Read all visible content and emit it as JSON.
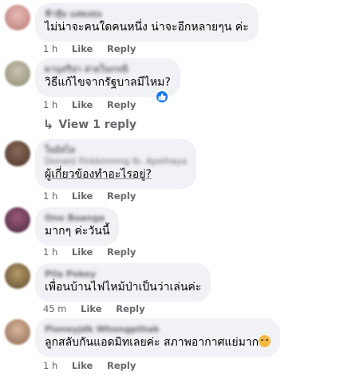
{
  "comments": [
    {
      "author": "ฟ้าสุ้ม แสดงธม",
      "text": "ไม่น่าจะคนใดคนหนึ่ง น่าจะอีกหลายๆน ค่ะ",
      "time": "1 h",
      "like": "Like",
      "reply": "Reply"
    },
    {
      "author": "ผานุจรีน่า ฝายในกรณี",
      "text": "วิธีแก้ไขจากรัฐบาลมีไหม?",
      "time": "1 h",
      "like": "Like",
      "reply": "Reply",
      "view_replies": "View 1 reply"
    },
    {
      "author": "ใจมัลไล",
      "author2": "Donald Finkkmmng Ib. Apelhaya",
      "text": "ผู้เกี่ยวข้องทำอะไรอยู่?",
      "time": "1 h",
      "like": "Like",
      "reply": "Reply"
    },
    {
      "author": "Ono Boanga",
      "text": "มากๆ ค่ะวันนี้",
      "time": "1 h",
      "like": "Like",
      "reply": "Reply"
    },
    {
      "author": "Pila Pokey",
      "text": "เพื่อนบ้านไฟไหม้ป่าเป็นว่าเล่นค่ะ",
      "time": "45 m",
      "like": "Like",
      "reply": "Reply"
    },
    {
      "author": "Pioneyjdk Whongpthak",
      "text": "ลูกสลับกันแอดมิทเลยค่ะ สภาพอากาศแย่มาก",
      "time": "1 h",
      "like": "Like",
      "reply": "Reply"
    }
  ],
  "icons": {
    "like_badge": "thumbs-up-icon",
    "reply_arrow": "reply-arrow-icon",
    "emoji": "tired-face-emoji"
  },
  "colors": {
    "bubble": "#f0f2f5",
    "meta_text": "#65676b",
    "like_blue": "#1877f2"
  }
}
